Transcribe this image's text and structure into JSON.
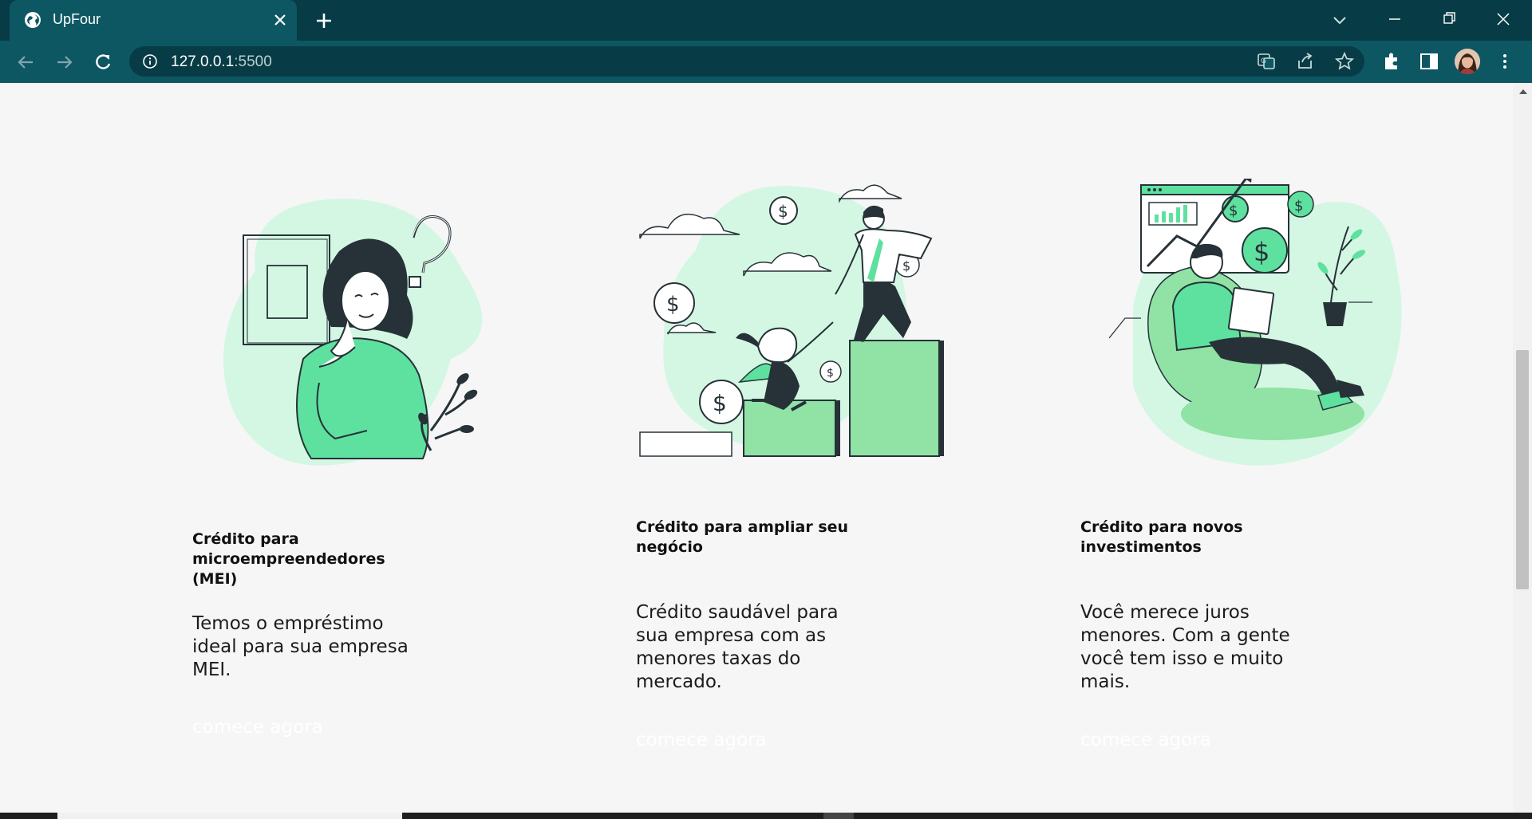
{
  "browser": {
    "tab_title": "UpFour",
    "tab_close_icon": "close-icon",
    "new_tab_icon": "plus-icon",
    "url_host": "127.0.0.1",
    "url_port": ":5500",
    "accent_color": "#0d5763",
    "dark_color": "#073c46"
  },
  "cards": [
    {
      "title": "Crédito para microempreendedores (MEI)",
      "text": "Temos o empréstimo ideal para sua empresa MEI.",
      "cta": "comece agora"
    },
    {
      "title": "Crédito para ampliar seu negócio",
      "text": "Crédito saudável para sua empresa com as menores taxas do mercado.",
      "cta": "comece agora"
    },
    {
      "title": "Crédito para novos investimentos",
      "text": "Você merece juros menores. Com a gente você tem isso e muito mais.",
      "cta": "comece agora"
    }
  ],
  "colors": {
    "mint": "#d4f7e3",
    "green": "#5ee19f",
    "dark": "#263238",
    "page_bg": "#f6f6f6"
  }
}
